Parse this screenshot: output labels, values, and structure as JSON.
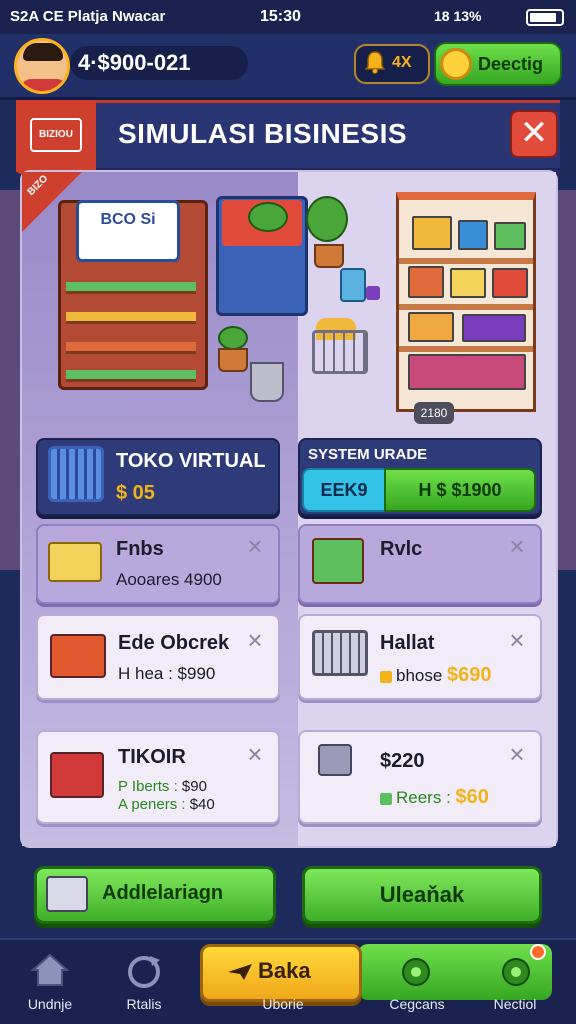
{
  "status_bar": {
    "left_text": "S2A CE Platja Nwacar",
    "time": "15:30",
    "right_text": "18 13%"
  },
  "header": {
    "money": "4·$900-021",
    "bell_count": "4X",
    "top_button_label": "Deectig"
  },
  "title_bar": {
    "ribbon_logo": "BIZIOU",
    "title": "SIMULASI BISINESIS",
    "close_symbol": "✕"
  },
  "panel": {
    "tag_text": "BIZO",
    "shop_sign": "BCO Si",
    "year_tag": "2180"
  },
  "cards": {
    "toko": {
      "name": "TOKO VIRTUAL",
      "price": "$ 05"
    },
    "upgrade": {
      "title": "SYSTEM URADE",
      "left_label": "EEK9",
      "right_label": "H $ $1900"
    },
    "c1": {
      "name": "Fnbs",
      "sub": "Aooares 4900"
    },
    "c2": {
      "name": "Rvlc"
    },
    "c3": {
      "name": "Ede Obcrek",
      "sub_prefix": "H hea : ",
      "sub_value": "$990"
    },
    "c4": {
      "name": "Hallat",
      "sub_prefix": "bhose ",
      "sub_value": "$690"
    },
    "c5": {
      "name": "TIKOIR",
      "line1_prefix": "P Iberts : ",
      "line1_value": "$90",
      "line2_prefix": "A peners : ",
      "line2_value": "$40"
    },
    "c6": {
      "name": "$220",
      "sub_prefix": "Reers : ",
      "sub_value": "$60"
    }
  },
  "actions": {
    "left_button": "Addlelariagn",
    "right_button": "Uleaňak"
  },
  "nav": {
    "items": [
      {
        "label": "Undnje",
        "icon": "home-icon"
      },
      {
        "label": "Rtalis",
        "icon": "refresh-icon"
      },
      {
        "label": "Uborie",
        "button": "Baka",
        "icon": "plane-icon"
      },
      {
        "label": "Cegcans",
        "icon": "gear-icon"
      },
      {
        "label": "Nectiol",
        "icon": "gear-icon"
      }
    ]
  },
  "colors": {
    "background": "#1f2a5c",
    "accent_green": "#3fb02a",
    "accent_red": "#e24a3b",
    "gold": "#f2b21a"
  }
}
